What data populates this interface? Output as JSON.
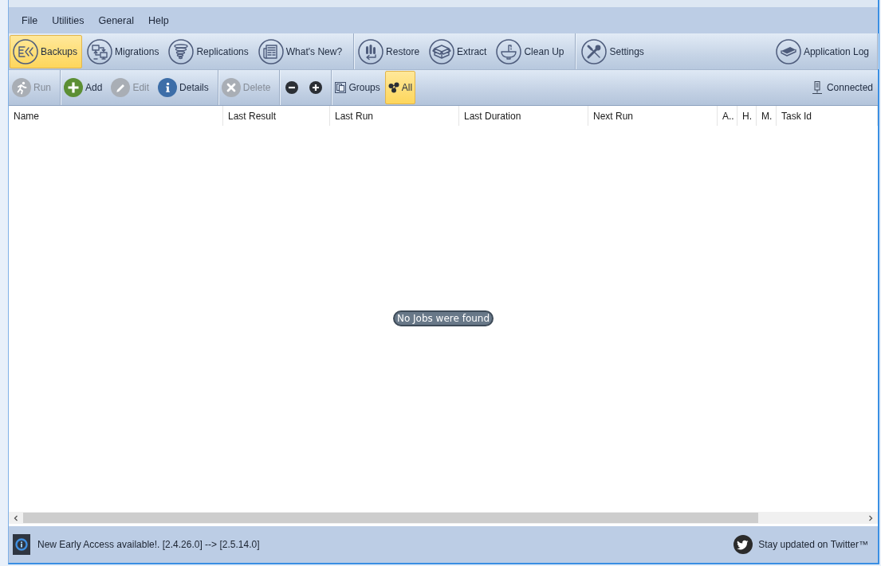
{
  "menu": [
    "File",
    "Utilities",
    "General",
    "Help"
  ],
  "main_toolbar": {
    "groups": [
      {
        "buttons": [
          {
            "label": "Backups",
            "selected": true
          },
          {
            "label": "Migrations",
            "selected": false
          },
          {
            "label": "Replications",
            "selected": false
          },
          {
            "label": "What's New?",
            "selected": false
          }
        ]
      },
      {
        "buttons": [
          {
            "label": "Restore",
            "selected": false
          },
          {
            "label": "Extract",
            "selected": false
          },
          {
            "label": "Clean Up",
            "selected": false
          }
        ]
      },
      {
        "buttons": [
          {
            "label": "Settings",
            "selected": false
          }
        ]
      }
    ],
    "log_button": {
      "label": "Application Log"
    }
  },
  "action_toolbar": {
    "groups": [
      {
        "buttons": [
          {
            "label": "Run",
            "disabled": true
          }
        ]
      },
      {
        "buttons": [
          {
            "label": "Add",
            "disabled": false
          },
          {
            "label": "Edit",
            "disabled": true
          },
          {
            "label": "Details",
            "disabled": false
          }
        ]
      },
      {
        "buttons": [
          {
            "label": "Delete",
            "disabled": true
          }
        ]
      }
    ],
    "view_toggles": [
      {
        "label": "Groups",
        "selected": false
      },
      {
        "label": "All",
        "selected": true
      }
    ],
    "connection": {
      "label": "Connected"
    }
  },
  "table": {
    "columns": [
      "Name",
      "Last Result",
      "Last Run",
      "Last Duration",
      "Next Run",
      "A..",
      "H.",
      "M.",
      "Task Id"
    ],
    "empty_message": "No Jobs were found"
  },
  "status_bar": {
    "message": "New Early Access available!. [2.4.26.0] --> [2.5.14.0]",
    "twitter_link": "Stay updated on Twitter™"
  }
}
